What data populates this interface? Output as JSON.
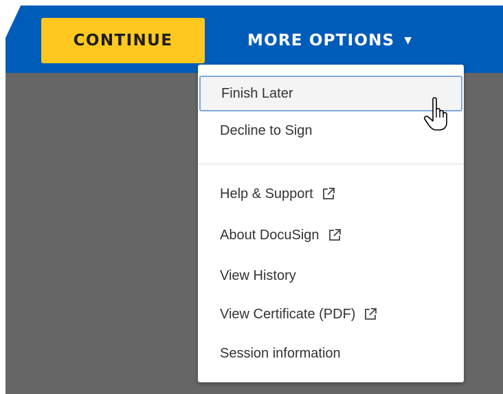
{
  "toolbar": {
    "continue_label": "CONTINUE",
    "more_options_label": "MORE OPTIONS",
    "caret_glyph": "▼"
  },
  "menu": {
    "items": [
      {
        "label": "Finish Later",
        "external": false,
        "focused": true
      },
      {
        "label": "Decline to Sign",
        "external": false
      },
      {
        "label": "Help & Support",
        "external": true
      },
      {
        "label": "About DocuSign",
        "external": true
      },
      {
        "label": "View History",
        "external": false
      },
      {
        "label": "View Certificate (PDF)",
        "external": true
      },
      {
        "label": "Session information",
        "external": false
      }
    ]
  },
  "colors": {
    "topbar": "#005cb9",
    "continue_button": "#ffc820",
    "backdrop": "#666666",
    "menu_bg": "#ffffff",
    "focus_outline": "#7fa7da"
  },
  "icons": {
    "external": "external-link-icon",
    "cursor": "hand-pointer-icon",
    "caret": "caret-down-icon"
  }
}
